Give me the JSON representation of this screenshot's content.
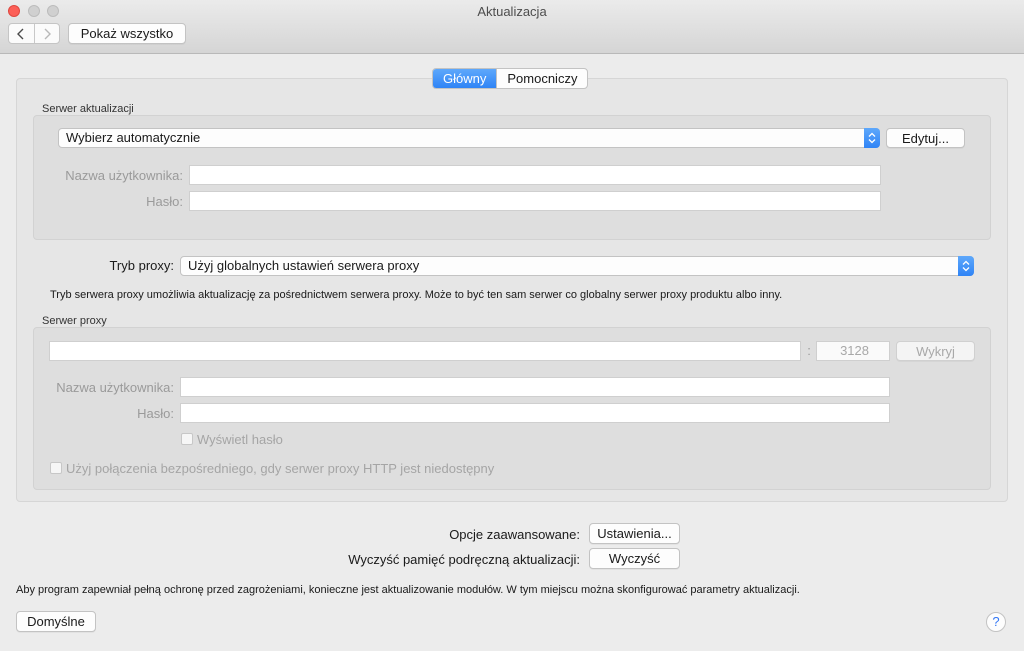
{
  "window": {
    "title": "Aktualizacja"
  },
  "toolbar": {
    "show_all": "Pokaż wszystko"
  },
  "tabs": [
    {
      "label": "Główny",
      "active": true
    },
    {
      "label": "Pomocniczy",
      "active": false
    }
  ],
  "update_server": {
    "section_label": "Serwer aktualizacji",
    "selected": "Wybierz automatycznie",
    "edit_button": "Edytuj...",
    "username_label": "Nazwa użytkownika:",
    "username_value": "",
    "password_label": "Hasło:",
    "password_value": ""
  },
  "proxy": {
    "mode_label": "Tryb proxy:",
    "mode_selected": "Użyj globalnych ustawień serwera proxy",
    "description": "Tryb serwera proxy umożliwia aktualizację za pośrednictwem serwera proxy. Może to być ten sam serwer co globalny serwer proxy produktu albo inny.",
    "section_label": "Serwer proxy",
    "address_value": "",
    "port_separator": ":",
    "port_value": "3128",
    "detect_button": "Wykryj",
    "username_label": "Nazwa użytkownika:",
    "username_value": "",
    "password_label": "Hasło:",
    "password_value": "",
    "show_password_label": "Wyświetl hasło",
    "show_password_checked": false,
    "direct_connection_label": "Użyj połączenia bezpośredniego, gdy serwer proxy HTTP jest niedostępny",
    "direct_connection_checked": false
  },
  "advanced": {
    "options_label": "Opcje zaawansowane:",
    "settings_button": "Ustawienia...",
    "clear_cache_label": "Wyczyść pamięć podręczną aktualizacji:",
    "clear_button": "Wyczyść"
  },
  "footer": {
    "info_text": "Aby program zapewniał pełną ochronę przed zagrożeniami, konieczne jest aktualizowanie modułów. W tym miejscu można skonfigurować parametry aktualizacji.",
    "defaults_button": "Domyślne",
    "help_button": "?"
  },
  "colors": {
    "accent": "#2f84f6",
    "close": "#fc5f57",
    "disabled_text": "#a8a8a8"
  }
}
